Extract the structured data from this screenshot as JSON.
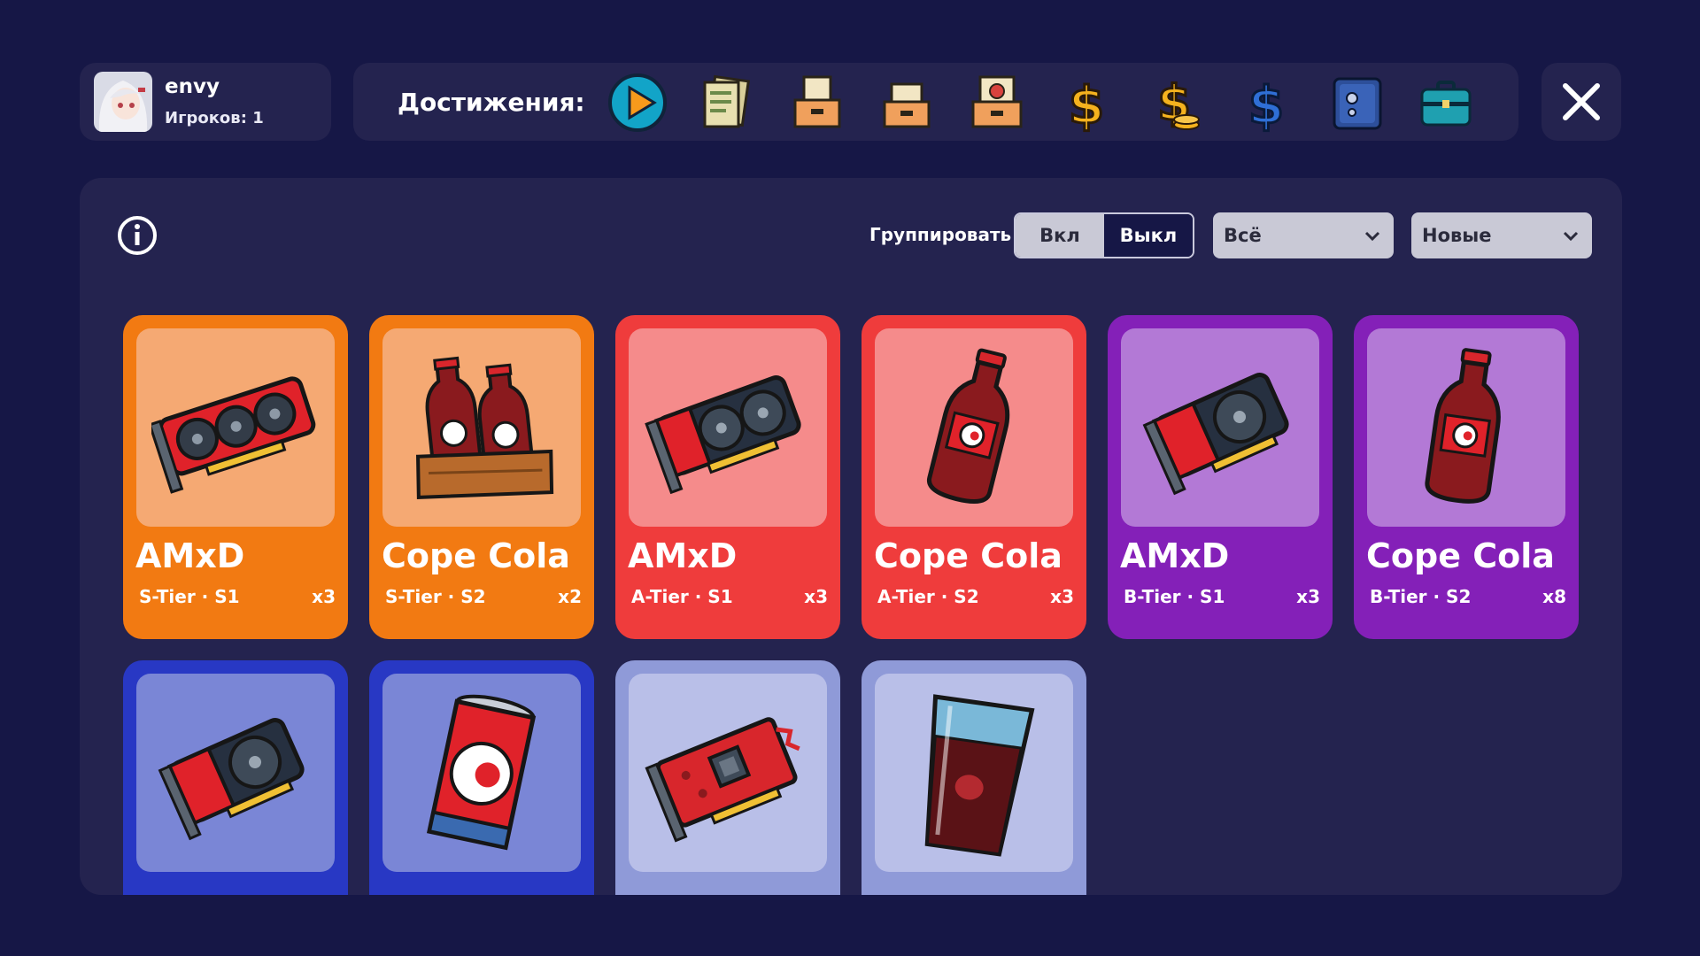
{
  "profile": {
    "name": "envy",
    "players_label": "Игроков:",
    "players_count": "1"
  },
  "achievements": {
    "label": "Достижения:",
    "icons": [
      "play-icon",
      "documents-icon",
      "folder-box-icon",
      "file-box-icon",
      "certificate-box-icon",
      "gold-dollar-icon",
      "dollar-coins-icon",
      "blue-dollar-icon",
      "safe-icon",
      "briefcase-icon"
    ]
  },
  "filters": {
    "group_label": "Группировать",
    "toggle_on": "Вкл",
    "toggle_off": "Выкл",
    "toggle_selected": "Вкл",
    "category_value": "Всё",
    "sort_value": "Новые"
  },
  "colors": {
    "s_tier": "#f27a12",
    "s_tier_art": "#f5a973",
    "a_tier": "#ef3c3c",
    "a_tier_art": "#f58b8b",
    "b_tier": "#8420b8",
    "b_tier_art": "#b379d6",
    "c_tier": "#2838c4",
    "c_tier_art": "#7a86d6",
    "d_tier": "#8f9ad8",
    "d_tier_art": "#b9bfe8"
  },
  "cards": [
    {
      "name": "AMxD",
      "tier": "S-Tier · S1",
      "count": "x3",
      "art": "gpu-triple-fan-icon"
    },
    {
      "name": "Cope Cola",
      "tier": "S-Tier · S2",
      "count": "x2",
      "art": "cola-crate-icon"
    },
    {
      "name": "AMxD",
      "tier": "A-Tier · S1",
      "count": "x3",
      "art": "gpu-dual-fan-icon"
    },
    {
      "name": "Cope Cola",
      "tier": "A-Tier · S2",
      "count": "x3",
      "art": "cola-bottle-icon"
    },
    {
      "name": "AMxD",
      "tier": "B-Tier · S1",
      "count": "x3",
      "art": "gpu-single-fan-icon"
    },
    {
      "name": "Cope Cola",
      "tier": "B-Tier · S2",
      "count": "x8",
      "art": "cola-bottle-icon"
    },
    {
      "name": "",
      "tier": "",
      "count": "",
      "art": "gpu-single-fan-icon"
    },
    {
      "name": "",
      "tier": "",
      "count": "",
      "art": "cola-can-icon"
    },
    {
      "name": "",
      "tier": "",
      "count": "",
      "art": "gpu-broken-icon"
    },
    {
      "name": "",
      "tier": "",
      "count": "",
      "art": "cola-glass-icon"
    }
  ]
}
